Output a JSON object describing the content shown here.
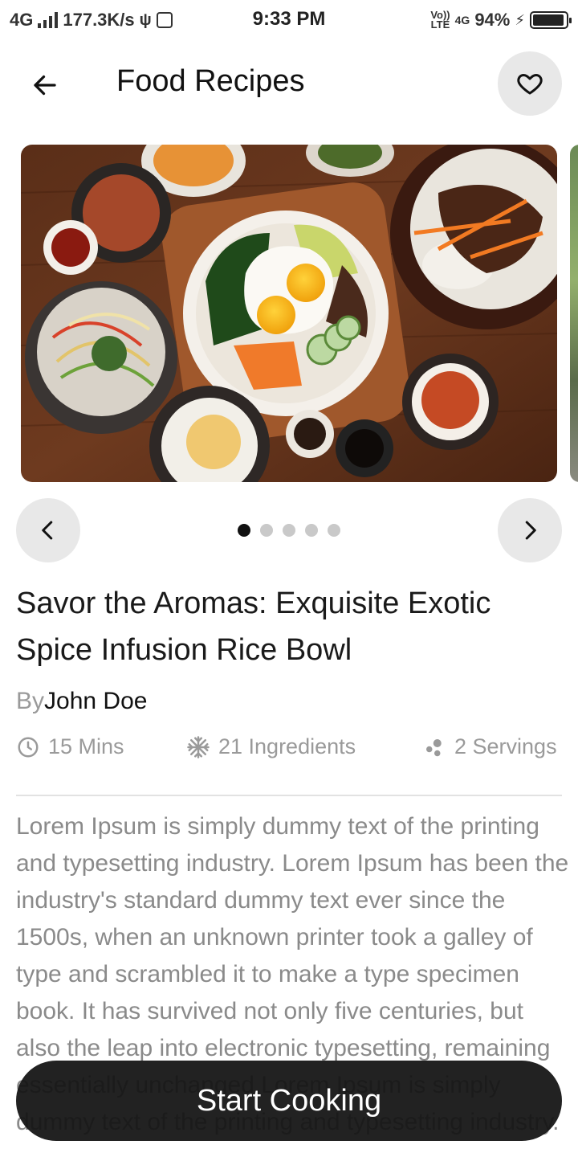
{
  "status_bar": {
    "network": "4G",
    "speed": "177.3K/s",
    "time": "9:33 PM",
    "volte_top": "Vo))",
    "volte_bottom": "LTE",
    "network2": "4G",
    "battery": "94%",
    "battery_level": 0.94
  },
  "header": {
    "title": "Food Recipes",
    "back_icon": "arrow-left-icon",
    "favorite_icon": "heart-icon"
  },
  "carousel": {
    "image_alt": "Bibimbap rice bowl with fried egg and side dishes",
    "prev_icon": "chevron-left-icon",
    "next_icon": "chevron-right-icon",
    "dot_count": 5,
    "active_index": 0
  },
  "recipe": {
    "title": "Savor the Aromas: Exquisite Exotic Spice Infusion Rice Bowl",
    "by_label": "By",
    "author": "John Doe",
    "time": "15 Mins",
    "ingredients": "21 Ingredients",
    "servings": "2 Servings",
    "description": "Lorem Ipsum is simply dummy text of the printing and typesetting industry. Lorem Ipsum has been the industry's standard dummy text ever since the 1500s, when an unknown printer took a galley of type and scrambled it to make a type specimen book. It has survived not only five centuries, but also the leap into electronic typesetting, remaining essentially unchanged.Lorem Ipsum is simply dummy text of the printing and typesetting industry."
  },
  "cta": {
    "label": "Start Cooking"
  },
  "colors": {
    "accent": "#1a1a1a",
    "muted": "#9a9a9a",
    "chip_bg": "#e8e8e8"
  }
}
